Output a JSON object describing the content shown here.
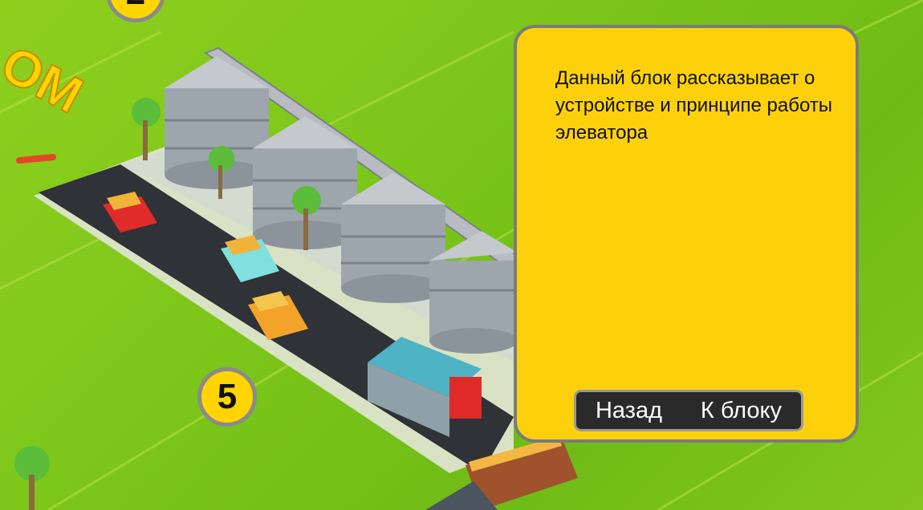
{
  "panel": {
    "description": "Данный блок рассказывает о устройстве и принципе работы элеватора",
    "back_label": "Назад",
    "to_block_label": "К блоку"
  },
  "map": {
    "block_number": "5",
    "block_number_partial": "2",
    "field_text_partial": "ОМ"
  },
  "colors": {
    "panel_bg": "#fcd10c",
    "panel_border": "#7b7b7b",
    "badge_bg": "#ffd400",
    "field_green": "#7cc61a",
    "nav_bg": "#2a2a2a"
  }
}
